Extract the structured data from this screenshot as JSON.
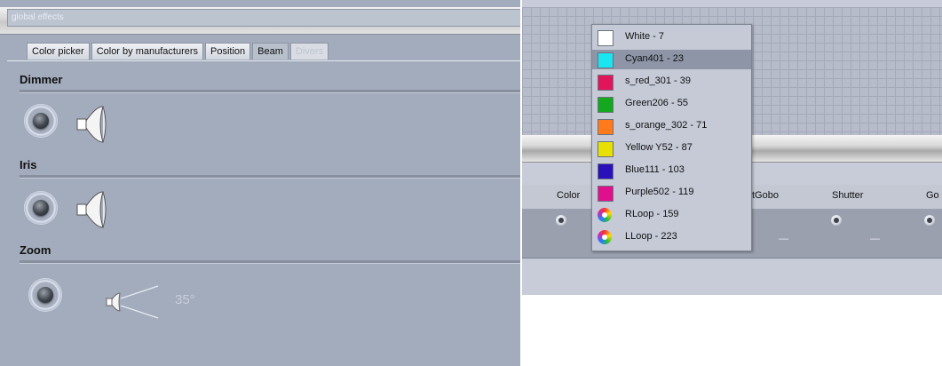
{
  "left": {
    "title": "global effects",
    "tabs": [
      {
        "label": "Color picker",
        "state": "normal"
      },
      {
        "label": "Color by manufacturers",
        "state": "normal"
      },
      {
        "label": "Position",
        "state": "normal"
      },
      {
        "label": "Beam",
        "state": "active"
      },
      {
        "label": "Divers",
        "state": "disabled"
      }
    ],
    "sections": {
      "dimmer": "Dimmer",
      "iris": "Iris",
      "zoom": "Zoom"
    },
    "zoom_value": "35°"
  },
  "right": {
    "columns": [
      "Color",
      "tGobo",
      "Shutter",
      "Go"
    ],
    "dashes": [
      "—",
      "—"
    ]
  },
  "dropdown": {
    "selected_index": 1,
    "items": [
      {
        "label": "White - 7",
        "color": "#ffffff"
      },
      {
        "label": "Cyan401 - 23",
        "color": "#19e6f0"
      },
      {
        "label": "s_red_301 - 39",
        "color": "#e0155a"
      },
      {
        "label": "Green206 - 55",
        "color": "#14a81e"
      },
      {
        "label": "s_orange_302 - 71",
        "color": "#ff7a1a"
      },
      {
        "label": "Yellow Y52 - 87",
        "color": "#e8e000"
      },
      {
        "label": "Blue111 - 103",
        "color": "#2a10b8"
      },
      {
        "label": "Purple502 - 119",
        "color": "#e0108c"
      },
      {
        "label": "RLoop - 159",
        "color": "rainbow-loop-icon"
      },
      {
        "label": "LLoop - 223",
        "color": "rainbow-loop-icon"
      }
    ]
  }
}
